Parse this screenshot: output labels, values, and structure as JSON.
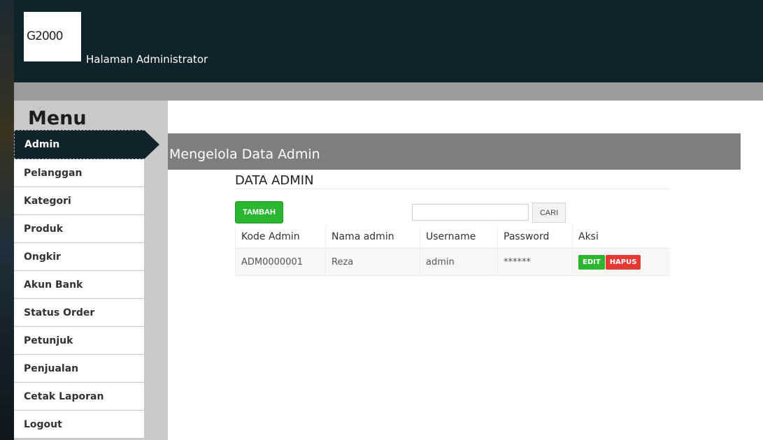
{
  "header": {
    "logo_text": "G2000",
    "title": "Halaman Administrator"
  },
  "sidebar": {
    "title": "Menu",
    "items": [
      {
        "label": "Admin",
        "active": true
      },
      {
        "label": "Pelanggan"
      },
      {
        "label": "Kategori"
      },
      {
        "label": "Produk"
      },
      {
        "label": "Ongkir"
      },
      {
        "label": "Akun Bank"
      },
      {
        "label": "Status Order"
      },
      {
        "label": "Petunjuk"
      },
      {
        "label": "Penjualan"
      },
      {
        "label": "Cetak Laporan"
      },
      {
        "label": "Logout"
      }
    ]
  },
  "main": {
    "page_title": "Mengelola Data Admin",
    "section_title": "DATA ADMIN",
    "add_button": "TAMBAH",
    "search": {
      "value": "",
      "placeholder": "",
      "button": "CARI"
    },
    "table": {
      "columns": [
        "Kode Admin",
        "Nama admin",
        "Username",
        "Password",
        "Aksi"
      ],
      "rows": [
        {
          "kode": "ADM0000001",
          "nama": "Reza",
          "username": "admin",
          "password": "******",
          "edit": "EDIT",
          "hapus": "HAPUS"
        }
      ]
    }
  },
  "colors": {
    "header_bg": "#10232b",
    "accent_green": "#2bb531",
    "danger_red": "#e53935",
    "content_header_bg": "#7e7e7e"
  }
}
